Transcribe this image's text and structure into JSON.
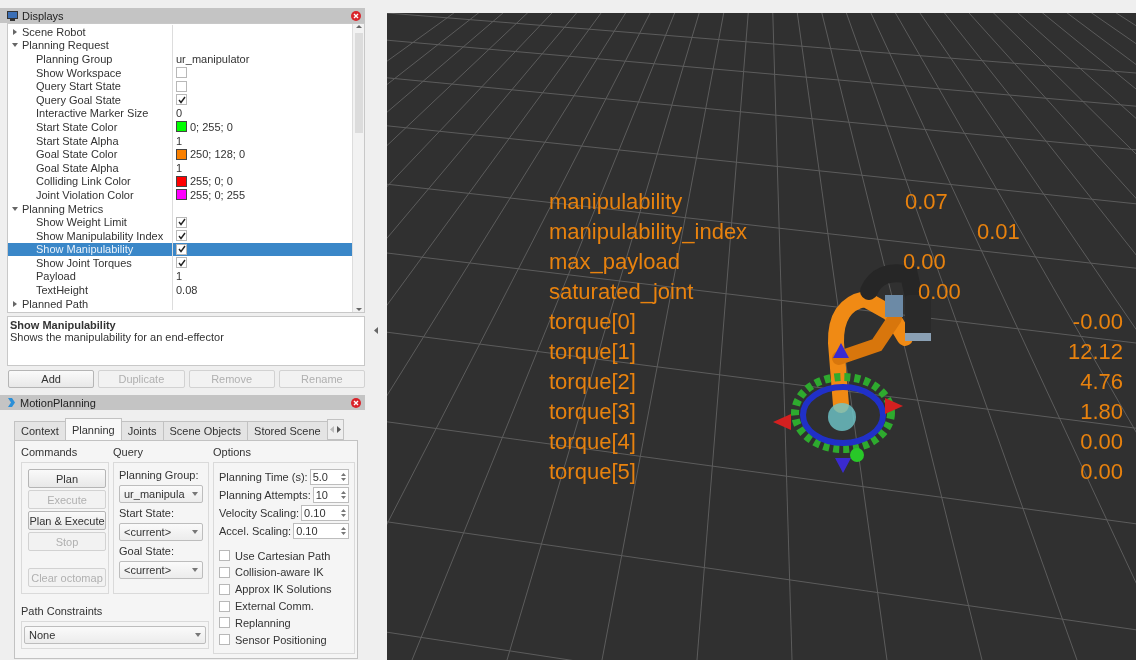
{
  "displays": {
    "title": "Displays",
    "tree": [
      {
        "label": "Scene Robot",
        "kind": "group",
        "expanded": false,
        "selected": false
      },
      {
        "label": "Planning Request",
        "kind": "group",
        "expanded": true,
        "selected": false,
        "children": [
          {
            "label": "Planning Group",
            "kind": "text",
            "value": "ur_manipulator",
            "selected": false
          },
          {
            "label": "Show Workspace",
            "kind": "checkbox",
            "checked": false,
            "selected": false
          },
          {
            "label": "Query Start State",
            "kind": "checkbox",
            "checked": false,
            "selected": false
          },
          {
            "label": "Query Goal State",
            "kind": "checkbox",
            "checked": true,
            "selected": false
          },
          {
            "label": "Interactive Marker Size",
            "kind": "text",
            "value": "0",
            "selected": false
          },
          {
            "label": "Start State Color",
            "kind": "color",
            "color": "#00ff00",
            "value": "0; 255; 0",
            "selected": false
          },
          {
            "label": "Start State Alpha",
            "kind": "text",
            "value": "1",
            "selected": false
          },
          {
            "label": "Goal State Color",
            "kind": "color",
            "color": "#fa8000",
            "value": "250; 128; 0",
            "selected": false
          },
          {
            "label": "Goal State Alpha",
            "kind": "text",
            "value": "1",
            "selected": false
          },
          {
            "label": "Colliding Link Color",
            "kind": "color",
            "color": "#ff0000",
            "value": "255; 0; 0",
            "selected": false
          },
          {
            "label": "Joint Violation Color",
            "kind": "color",
            "color": "#ff00ff",
            "value": "255; 0; 255",
            "selected": false
          }
        ]
      },
      {
        "label": "Planning Metrics",
        "kind": "group",
        "expanded": true,
        "selected": false,
        "children": [
          {
            "label": "Show Weight Limit",
            "kind": "checkbox",
            "checked": true,
            "selected": false
          },
          {
            "label": "Show Manipulability Index",
            "kind": "checkbox",
            "checked": true,
            "selected": false
          },
          {
            "label": "Show Manipulability",
            "kind": "checkbox",
            "checked": true,
            "selected": true
          },
          {
            "label": "Show Joint Torques",
            "kind": "checkbox",
            "checked": true,
            "selected": false
          },
          {
            "label": "Payload",
            "kind": "text",
            "value": "1",
            "selected": false
          },
          {
            "label": "TextHeight",
            "kind": "text",
            "value": "0.08",
            "selected": false
          }
        ]
      },
      {
        "label": "Planned Path",
        "kind": "group",
        "expanded": false,
        "selected": false
      }
    ]
  },
  "description": {
    "title": "Show Manipulability",
    "text": "Shows the manipulability for an end-effector"
  },
  "display_buttons": [
    {
      "label": "Add",
      "disabled": false
    },
    {
      "label": "Duplicate",
      "disabled": true
    },
    {
      "label": "Remove",
      "disabled": true
    },
    {
      "label": "Rename",
      "disabled": true
    }
  ],
  "motion_planning": {
    "title": "MotionPlanning",
    "tabs": [
      {
        "label": "Context",
        "selected": false
      },
      {
        "label": "Planning",
        "selected": true
      },
      {
        "label": "Joints",
        "selected": false
      },
      {
        "label": "Scene Objects",
        "selected": false
      },
      {
        "label": "Stored Scene",
        "selected": false
      }
    ],
    "commands": {
      "title": "Commands",
      "buttons": [
        {
          "label": "Plan",
          "disabled": false
        },
        {
          "label": "Execute",
          "disabled": true
        },
        {
          "label": "Plan & Execute",
          "disabled": false
        },
        {
          "label": "Stop",
          "disabled": true
        },
        {
          "label": "Clear octomap",
          "disabled": true
        }
      ]
    },
    "query": {
      "title": "Query",
      "fields": [
        {
          "label": "Planning Group:",
          "value": "ur_manipula"
        },
        {
          "label": "Start State:",
          "value": "<current>"
        },
        {
          "label": "Goal State:",
          "value": "<current>"
        }
      ]
    },
    "options": {
      "title": "Options",
      "spinboxes": [
        {
          "label": "Planning Time (s):",
          "value": "5.0"
        },
        {
          "label": "Planning Attempts:",
          "value": "10"
        },
        {
          "label": "Velocity Scaling:",
          "value": "0.10"
        },
        {
          "label": "Accel. Scaling:",
          "value": "0.10"
        }
      ],
      "checkboxes": [
        {
          "label": "Use Cartesian Path",
          "checked": false
        },
        {
          "label": "Collision-aware IK",
          "checked": false
        },
        {
          "label": "Approx IK Solutions",
          "checked": false
        },
        {
          "label": "External Comm.",
          "checked": false
        },
        {
          "label": "Replanning",
          "checked": false
        },
        {
          "label": "Sensor Positioning",
          "checked": false
        }
      ]
    },
    "path_constraints": {
      "label": "Path Constraints",
      "value": "None"
    }
  },
  "viewport": {
    "metrics": [
      {
        "label": "manipulability",
        "value": "0.07"
      },
      {
        "label": "manipulability_index",
        "value": "0.01"
      },
      {
        "label": "max_payload",
        "value": "0.00"
      },
      {
        "label": "saturated_joint",
        "value": "0.00"
      },
      {
        "label": "torque[0]",
        "value": "-0.00"
      },
      {
        "label": "torque[1]",
        "value": "12.12"
      },
      {
        "label": "torque[2]",
        "value": "4.76"
      },
      {
        "label": "torque[3]",
        "value": "1.80"
      },
      {
        "label": "torque[4]",
        "value": "0.00"
      },
      {
        "label": "torque[5]",
        "value": "0.00"
      }
    ]
  }
}
